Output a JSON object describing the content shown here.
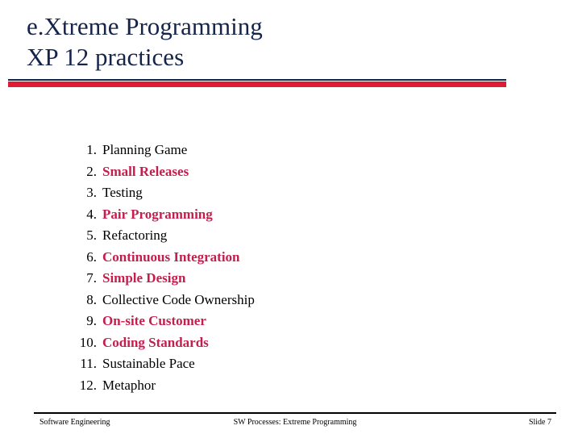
{
  "slide": {
    "title_lines": [
      "e.Xtreme Programming",
      "XP 12 practices"
    ],
    "title_color": "#15244A",
    "divider": {
      "navy_color": "#15244A",
      "red_color": "#E01A35"
    },
    "practices": [
      {
        "number": "1.",
        "label": "Planning Game",
        "color": "black"
      },
      {
        "number": "2.",
        "label": "Small Releases",
        "color": "red"
      },
      {
        "number": "3.",
        "label": "Testing",
        "color": "black"
      },
      {
        "number": "4.",
        "label": "Pair Programming",
        "color": "red"
      },
      {
        "number": "5.",
        "label": "Refactoring",
        "color": "black"
      },
      {
        "number": "6.",
        "label": "Continuous Integration",
        "color": "red"
      },
      {
        "number": "7.",
        "label": "Simple Design",
        "color": "red"
      },
      {
        "number": "8.",
        "label": "Collective Code Ownership",
        "color": "black"
      },
      {
        "number": "9.",
        "label": "On-site Customer",
        "color": "red"
      },
      {
        "number": "10.",
        "label": "Coding Standards",
        "color": "red"
      },
      {
        "number": "11.",
        "label": "Sustainable Pace",
        "color": "black"
      },
      {
        "number": "12.",
        "label": "Metaphor",
        "color": "black"
      }
    ],
    "practice_text_colors": {
      "black": "#000000",
      "red": "#C41E4E"
    },
    "footer": {
      "left": "Software Engineering",
      "center": "SW Processes: Extreme Programming",
      "right": "Slide  7"
    }
  }
}
